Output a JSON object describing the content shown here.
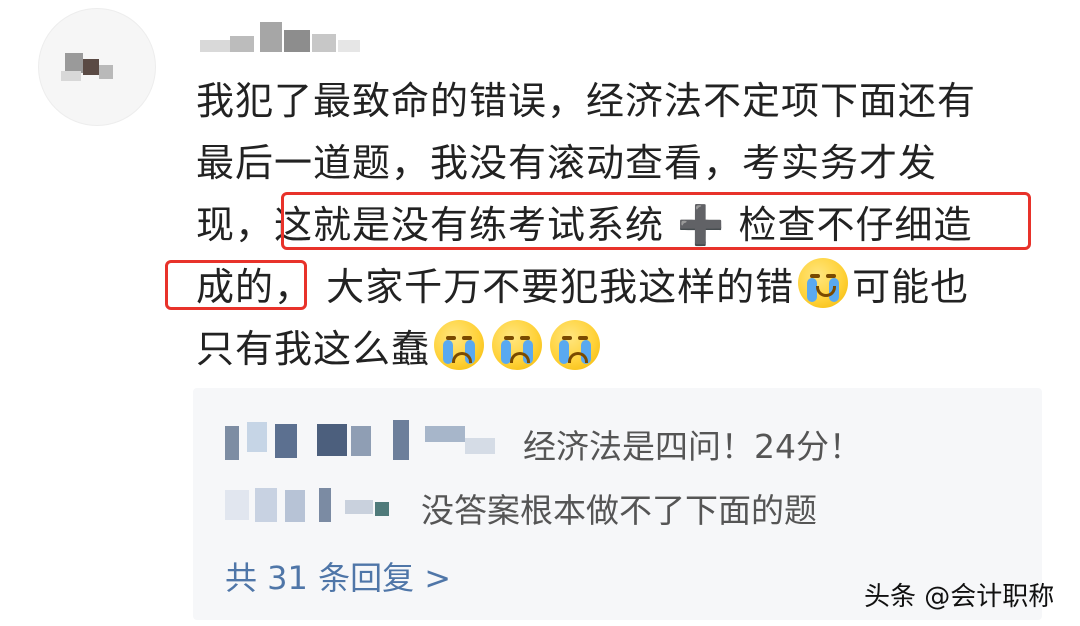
{
  "comment": {
    "lines": [
      "我犯了最致命的错误，经济法不定项下面还有",
      "最后一道题，我没有滚动查看，考实务才发",
      "现，",
      "这就是没有练考试系统",
      "检查不仔细造",
      "成的，",
      "大家千万不要犯我这样的错",
      "可能也",
      "只有我这么蠢"
    ],
    "plus_symbol": "➕",
    "emojis": [
      "laugh-cry-icon",
      "crying-icon",
      "crying-icon",
      "crying-icon"
    ]
  },
  "replies": {
    "items": [
      {
        "text": "经济法是四问！24分！"
      },
      {
        "text": "没答案根本做不了下面的题"
      }
    ],
    "more_label": "共 31 条回复 >"
  },
  "watermark": "头条 @会计职称",
  "colors": {
    "highlight": "#e8322a",
    "link": "#4f76a8",
    "reply_bg": "#f6f7f9"
  }
}
